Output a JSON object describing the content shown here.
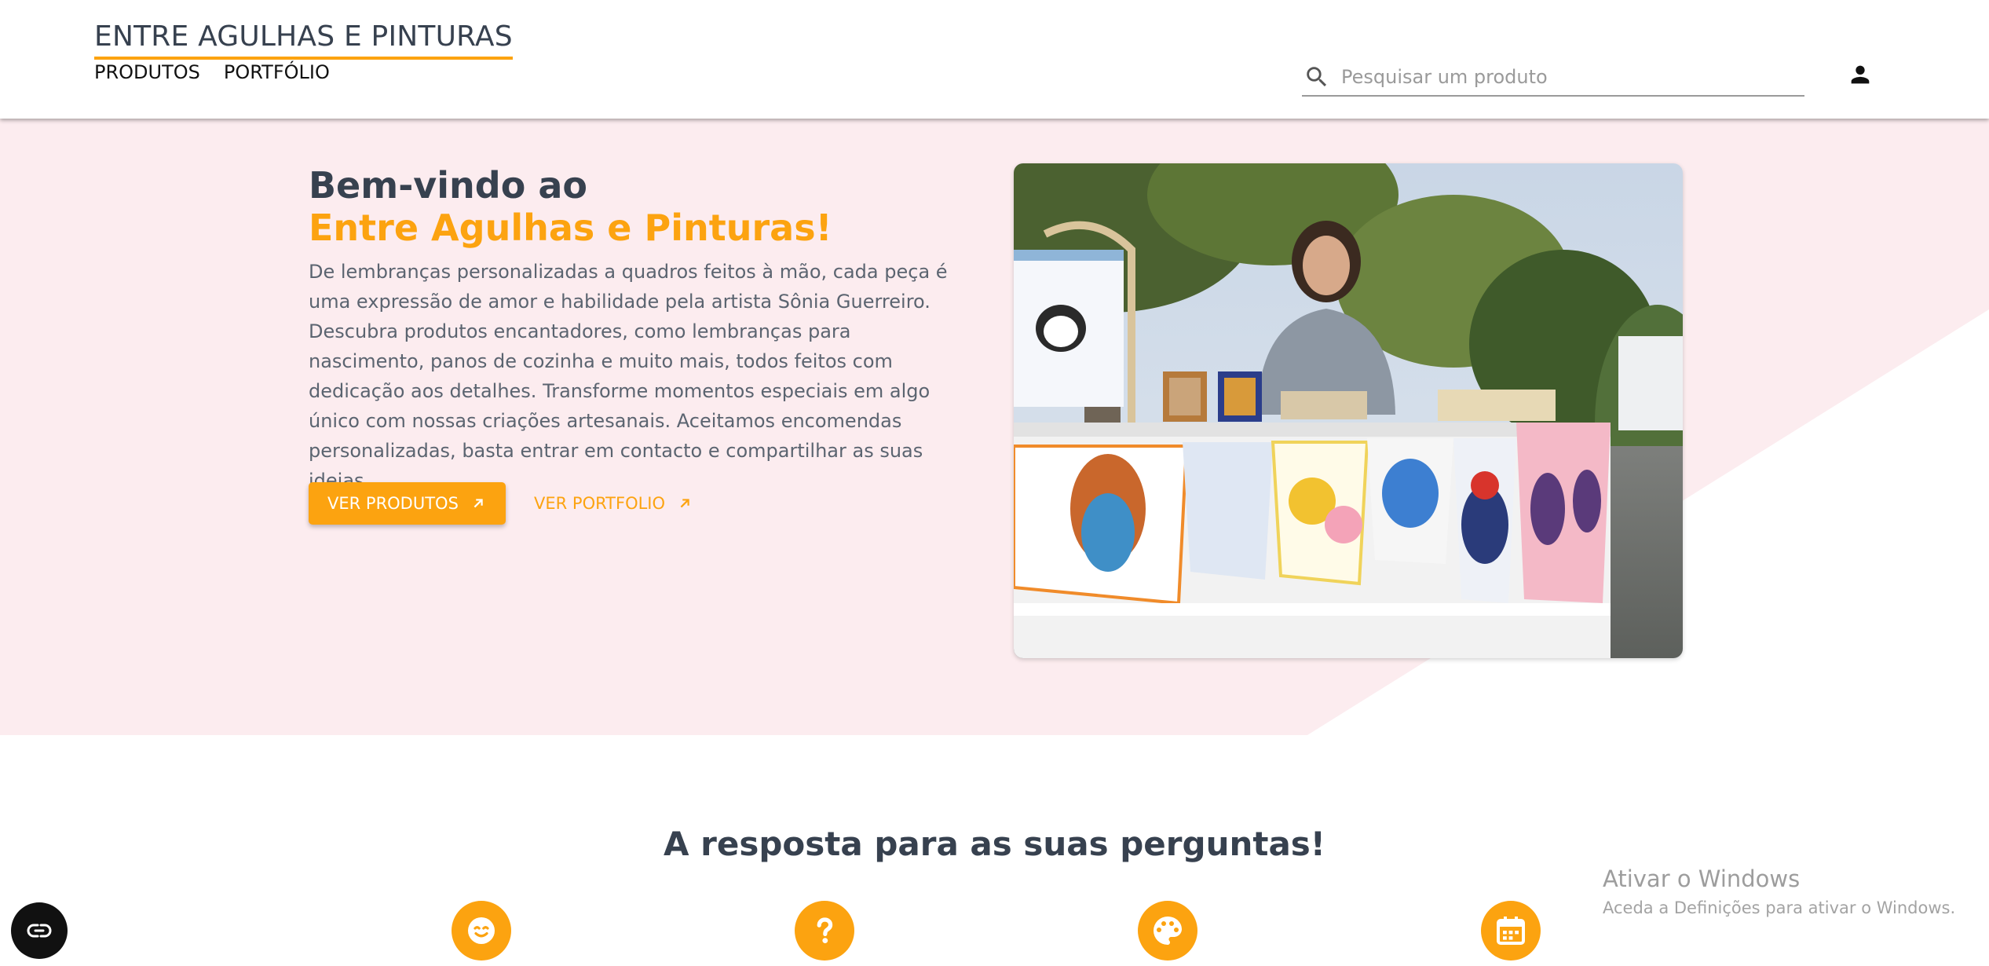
{
  "header": {
    "brand": "ENTRE AGULHAS E PINTURAS",
    "nav": [
      {
        "label": "PRODUTOS"
      },
      {
        "label": "PORTFÓLIO"
      }
    ],
    "search": {
      "placeholder": "Pesquisar um produto",
      "icon": "search-icon"
    },
    "account_icon": "person-icon"
  },
  "hero": {
    "title_line1": "Bem-vindo ao",
    "title_line2": "Entre Agulhas e Pinturas!",
    "description": "De lembranças personalizadas a quadros feitos à mão, cada peça é uma expressão de amor e habilidade pela artista Sônia Guerreiro. Descubra produtos encantadores, como lembranças para nascimento, panos de cozinha e muito mais, todos feitos com dedicação aos detalhes. Transforme momentos especiais em algo único com nossas criações artesanais. Aceitamos encomendas personalizadas, basta entrar em contacto e compartilhar as suas ideias.",
    "primary_button": "VER PRODUTOS",
    "secondary_button": "VER PORTFOLIO",
    "button_icon": "arrow-up-right-icon"
  },
  "faq": {
    "title": "A resposta para as suas perguntas!",
    "icons": [
      "smiley-icon",
      "question-icon",
      "palette-icon",
      "calendar-icon"
    ]
  },
  "watermark": {
    "title": "Ativar o Windows",
    "subtitle": "Aceda a Definições para ativar o Windows."
  },
  "floating_widget_icon": "accessibility-icon",
  "colors": {
    "accent": "#fca310",
    "text_dark": "#37414f",
    "hero_background": "#fcecef",
    "body_text": "#5b6470"
  }
}
